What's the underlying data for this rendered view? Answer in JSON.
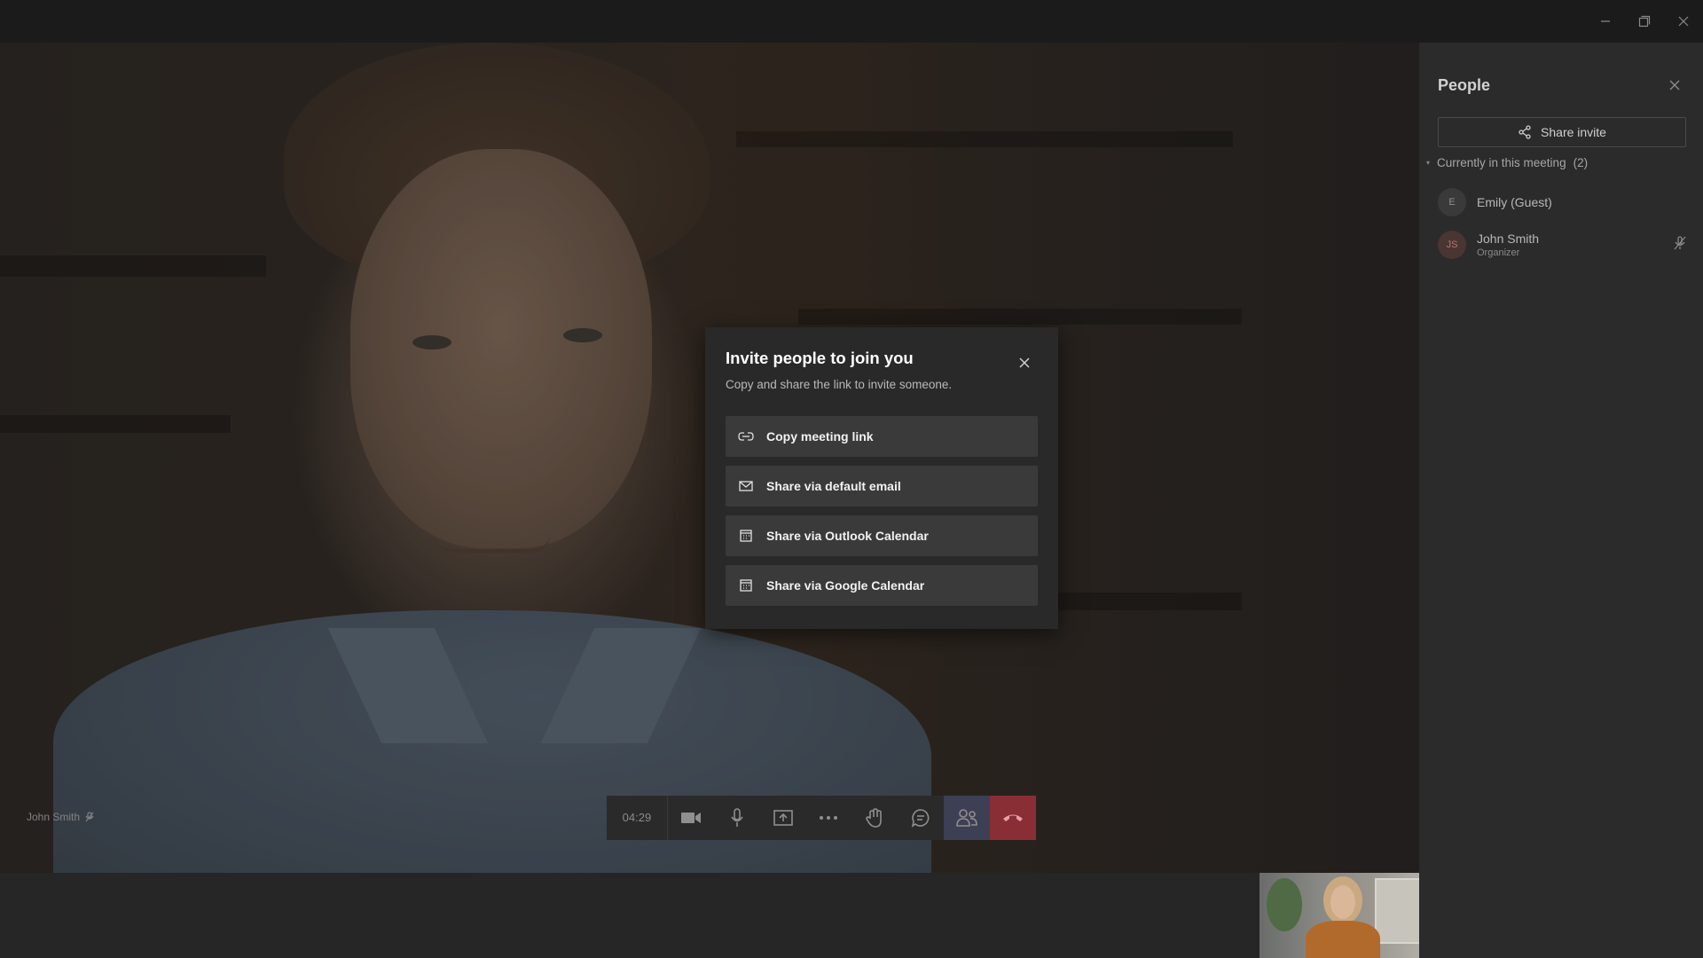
{
  "meeting": {
    "timer": "04:29",
    "speaker_name": "John Smith"
  },
  "people_panel": {
    "title": "People",
    "share_invite_label": "Share invite",
    "section_label": "Currently in this meeting",
    "section_count": "(2)",
    "participants": [
      {
        "initials": "E",
        "name": "Emily (Guest)",
        "role": "",
        "avatar_color": "#3a3a3a",
        "muted": false
      },
      {
        "initials": "JS",
        "name": "John Smith",
        "role": "Organizer",
        "avatar_color": "#4a3532",
        "muted": true
      }
    ]
  },
  "invite_dialog": {
    "title": "Invite people to join you",
    "subtitle": "Copy and share the link to invite someone.",
    "options": [
      {
        "label": "Copy meeting link",
        "icon": "link-icon"
      },
      {
        "label": "Share via default email",
        "icon": "mail-icon"
      },
      {
        "label": "Share via Outlook Calendar",
        "icon": "calendar-icon"
      },
      {
        "label": "Share via Google Calendar",
        "icon": "calendar-icon"
      }
    ]
  },
  "controls": [
    {
      "name": "camera-button",
      "icon": "video-camera-icon"
    },
    {
      "name": "mic-button",
      "icon": "microphone-icon"
    },
    {
      "name": "share-screen-button",
      "icon": "share-tray-icon"
    },
    {
      "name": "more-actions-button",
      "icon": "ellipsis-icon"
    },
    {
      "name": "raise-hand-button",
      "icon": "hand-icon"
    },
    {
      "name": "chat-button",
      "icon": "chat-bubble-icon"
    },
    {
      "name": "people-button",
      "icon": "people-icon"
    },
    {
      "name": "hang-up-button",
      "icon": "phone-hangup-icon"
    }
  ],
  "colors": {
    "people_button_bg": "#3d3f55",
    "hangup_bg": "#8a2e35"
  }
}
